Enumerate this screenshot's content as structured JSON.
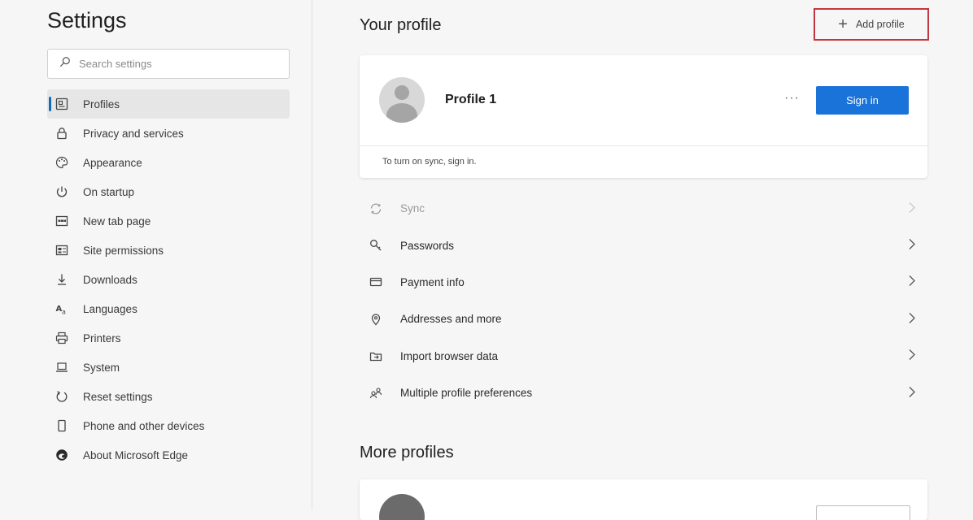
{
  "sidebar": {
    "title": "Settings",
    "search_placeholder": "Search settings",
    "items": [
      {
        "label": "Profiles",
        "icon": "profile-card-icon",
        "selected": true
      },
      {
        "label": "Privacy and services",
        "icon": "lock-icon"
      },
      {
        "label": "Appearance",
        "icon": "palette-icon"
      },
      {
        "label": "On startup",
        "icon": "power-icon"
      },
      {
        "label": "New tab page",
        "icon": "new-tab-icon"
      },
      {
        "label": "Site permissions",
        "icon": "site-permissions-icon"
      },
      {
        "label": "Downloads",
        "icon": "download-icon"
      },
      {
        "label": "Languages",
        "icon": "languages-icon"
      },
      {
        "label": "Printers",
        "icon": "printer-icon"
      },
      {
        "label": "System",
        "icon": "laptop-icon"
      },
      {
        "label": "Reset settings",
        "icon": "reset-icon"
      },
      {
        "label": "Phone and other devices",
        "icon": "phone-icon"
      },
      {
        "label": "About Microsoft Edge",
        "icon": "edge-logo-icon"
      }
    ]
  },
  "main": {
    "title": "Your profile",
    "add_profile_label": "Add profile",
    "profile": {
      "name": "Profile 1",
      "more_label": "···",
      "sign_in_label": "Sign in",
      "sync_hint": "To turn on sync, sign in."
    },
    "menu": [
      {
        "label": "Sync",
        "icon": "sync-icon",
        "disabled": true
      },
      {
        "label": "Passwords",
        "icon": "key-icon"
      },
      {
        "label": "Payment info",
        "icon": "credit-card-icon"
      },
      {
        "label": "Addresses and more",
        "icon": "location-pin-icon"
      },
      {
        "label": "Import browser data",
        "icon": "import-icon"
      },
      {
        "label": "Multiple profile preferences",
        "icon": "multiple-profiles-icon"
      }
    ],
    "more_profiles_title": "More profiles"
  },
  "colors": {
    "accent": "#1a73d9",
    "highlight_border": "#c1373f",
    "selected_indicator": "#0f6cbd"
  }
}
